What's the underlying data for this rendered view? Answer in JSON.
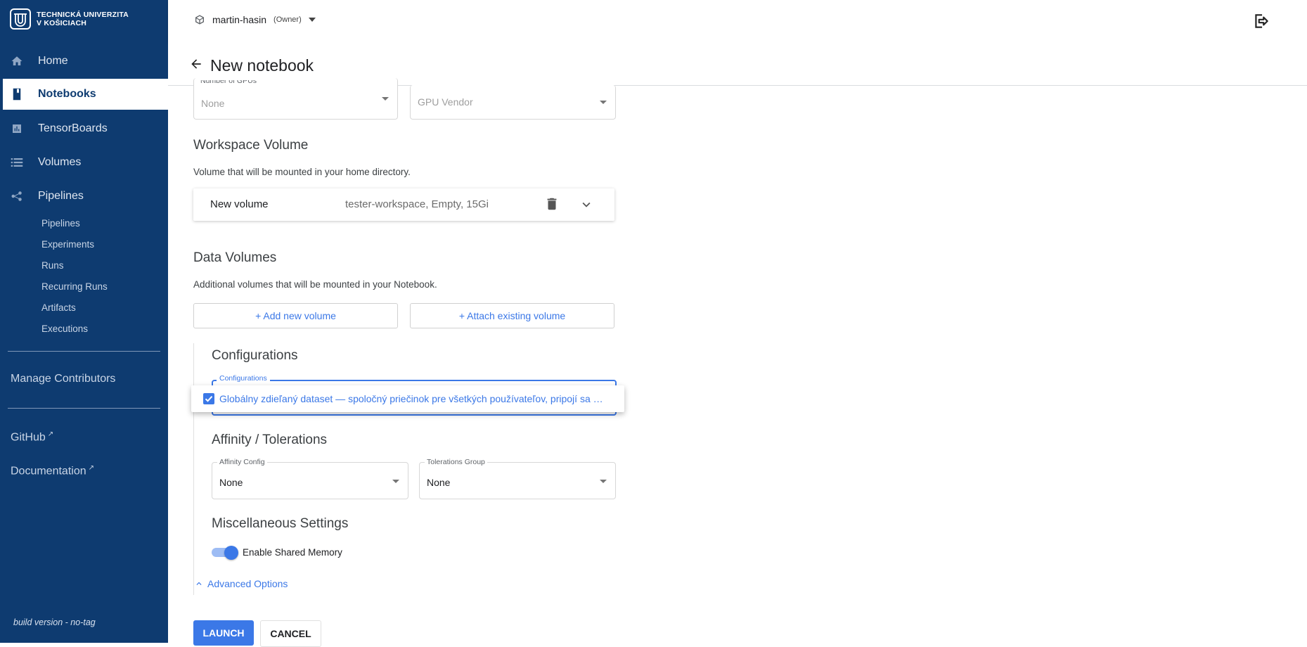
{
  "brand": {
    "line1": "TECHNICKÁ UNIVERZITA",
    "line2": "V KOŠICIACH"
  },
  "sidebar": {
    "items": [
      {
        "label": "Home",
        "icon": "home-icon"
      },
      {
        "label": "Notebooks",
        "icon": "notebook-icon",
        "active": true
      },
      {
        "label": "TensorBoards",
        "icon": "chart-icon"
      },
      {
        "label": "Volumes",
        "icon": "volumes-icon"
      },
      {
        "label": "Pipelines",
        "icon": "pipeline-icon"
      }
    ],
    "pipeline_sub": [
      "Pipelines",
      "Experiments",
      "Runs",
      "Recurring Runs",
      "Artifacts",
      "Executions"
    ],
    "manage": "Manage Contributors",
    "github": "GitHub",
    "docs": "Documentation",
    "build": "build version - no-tag"
  },
  "topbar": {
    "namespace": "martin-hasin",
    "role": "(Owner)"
  },
  "page": {
    "title": "New notebook"
  },
  "gpu": {
    "count_label": "Number of GPUs",
    "count_value": "None",
    "vendor_placeholder": "GPU Vendor"
  },
  "workspace": {
    "title": "Workspace Volume",
    "desc": "Volume that will be mounted in your home directory.",
    "volume_name": "New volume",
    "volume_desc": "tester-workspace, Empty, 15Gi"
  },
  "data_volumes": {
    "title": "Data Volumes",
    "desc": "Additional volumes that will be mounted in your Notebook.",
    "add_label": "+ Add new volume",
    "attach_label": "+ Attach existing volume"
  },
  "configurations": {
    "title": "Configurations",
    "field_label": "Configurations",
    "option": "Globálny zdieľaný dataset — spoločný priečinok pre všetkých používateľov, pripojí sa …",
    "checked": true
  },
  "affinity": {
    "title": "Affinity / Tolerations",
    "affinity_label": "Affinity Config",
    "affinity_value": "None",
    "tolerations_label": "Tolerations Group",
    "tolerations_value": "None"
  },
  "misc": {
    "title": "Miscellaneous Settings",
    "shared_memory": "Enable Shared Memory",
    "shared_memory_enabled": true
  },
  "advanced": "Advanced Options",
  "actions": {
    "launch": "LAUNCH",
    "cancel": "CANCEL"
  },
  "colors": {
    "sidebar": "#0e3b70",
    "accent": "#3b78e7"
  }
}
